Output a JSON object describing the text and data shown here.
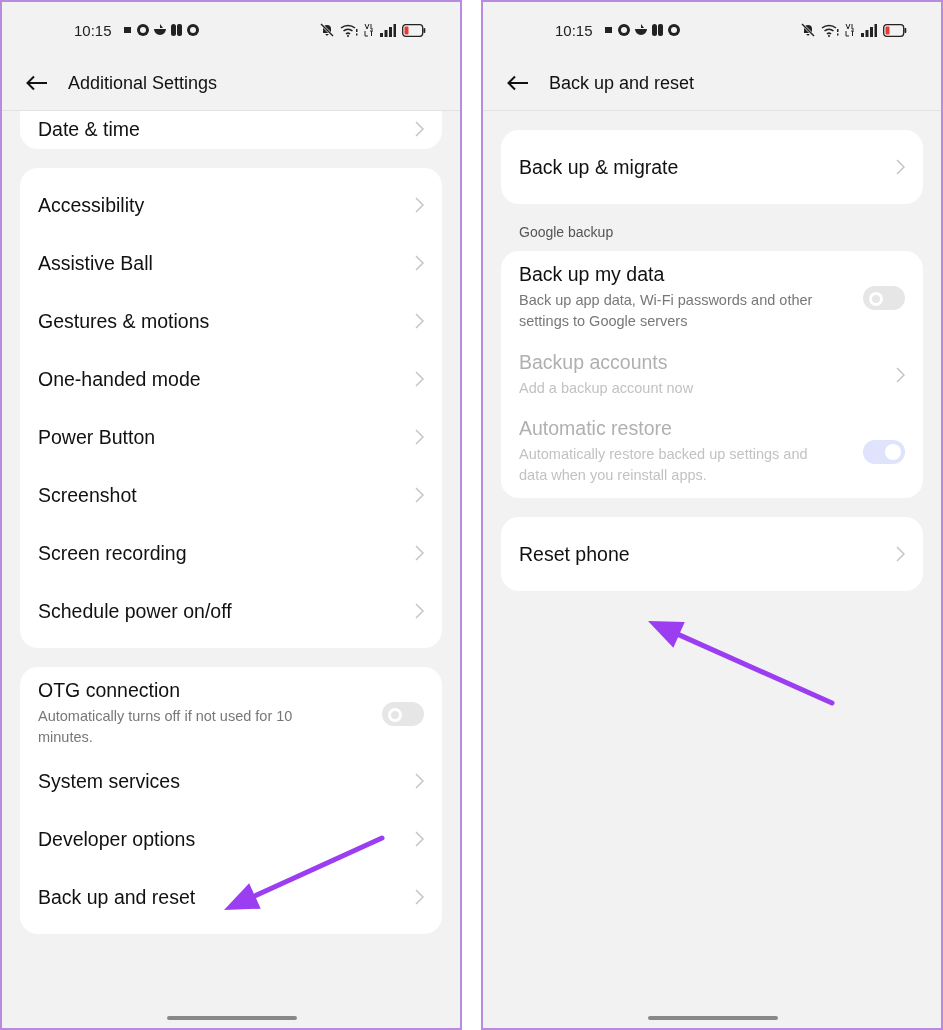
{
  "screens": [
    {
      "status_bar": {
        "time": "10:15"
      },
      "title": "Additional Settings",
      "sections": [
        {
          "items": [
            {
              "kind": "link",
              "title": "Date & time",
              "disabled": false
            }
          ]
        },
        {
          "items": [
            {
              "kind": "link",
              "title": "Accessibility",
              "disabled": false
            },
            {
              "kind": "link",
              "title": "Assistive Ball",
              "disabled": false
            },
            {
              "kind": "link",
              "title": "Gestures & motions",
              "disabled": false
            },
            {
              "kind": "link",
              "title": "One-handed mode",
              "disabled": false
            },
            {
              "kind": "link",
              "title": "Power Button",
              "disabled": false
            },
            {
              "kind": "link",
              "title": "Screenshot",
              "disabled": false
            },
            {
              "kind": "link",
              "title": "Screen recording",
              "disabled": false
            },
            {
              "kind": "link",
              "title": "Schedule power on/off",
              "disabled": false
            }
          ]
        },
        {
          "items": [
            {
              "kind": "toggle",
              "title": "OTG connection",
              "subtitle": "Automatically turns off if not used for 10 minutes.",
              "on": false,
              "disabled": false
            },
            {
              "kind": "link",
              "title": "System services",
              "disabled": false
            },
            {
              "kind": "link",
              "title": "Developer options",
              "disabled": false
            },
            {
              "kind": "link",
              "title": "Back up and reset",
              "disabled": false
            }
          ]
        }
      ]
    },
    {
      "status_bar": {
        "time": "10:15"
      },
      "title": "Back up and reset",
      "sections": [
        {
          "items": [
            {
              "kind": "link",
              "title": "Back up & migrate",
              "disabled": false
            }
          ]
        },
        {
          "header": "Google backup",
          "items": [
            {
              "kind": "toggle",
              "title": "Back up my data",
              "subtitle": "Back up app data, Wi-Fi passwords and other settings to Google servers",
              "on": false,
              "disabled": false
            },
            {
              "kind": "link",
              "title": "Backup accounts",
              "subtitle": "Add a backup account now",
              "disabled": true
            },
            {
              "kind": "toggle",
              "title": "Automatic restore",
              "subtitle": "Automatically restore backed up settings and data when you reinstall apps.",
              "on": true,
              "disabled": true
            }
          ]
        },
        {
          "items": [
            {
              "kind": "link",
              "title": "Reset phone",
              "disabled": false
            }
          ]
        }
      ]
    }
  ]
}
